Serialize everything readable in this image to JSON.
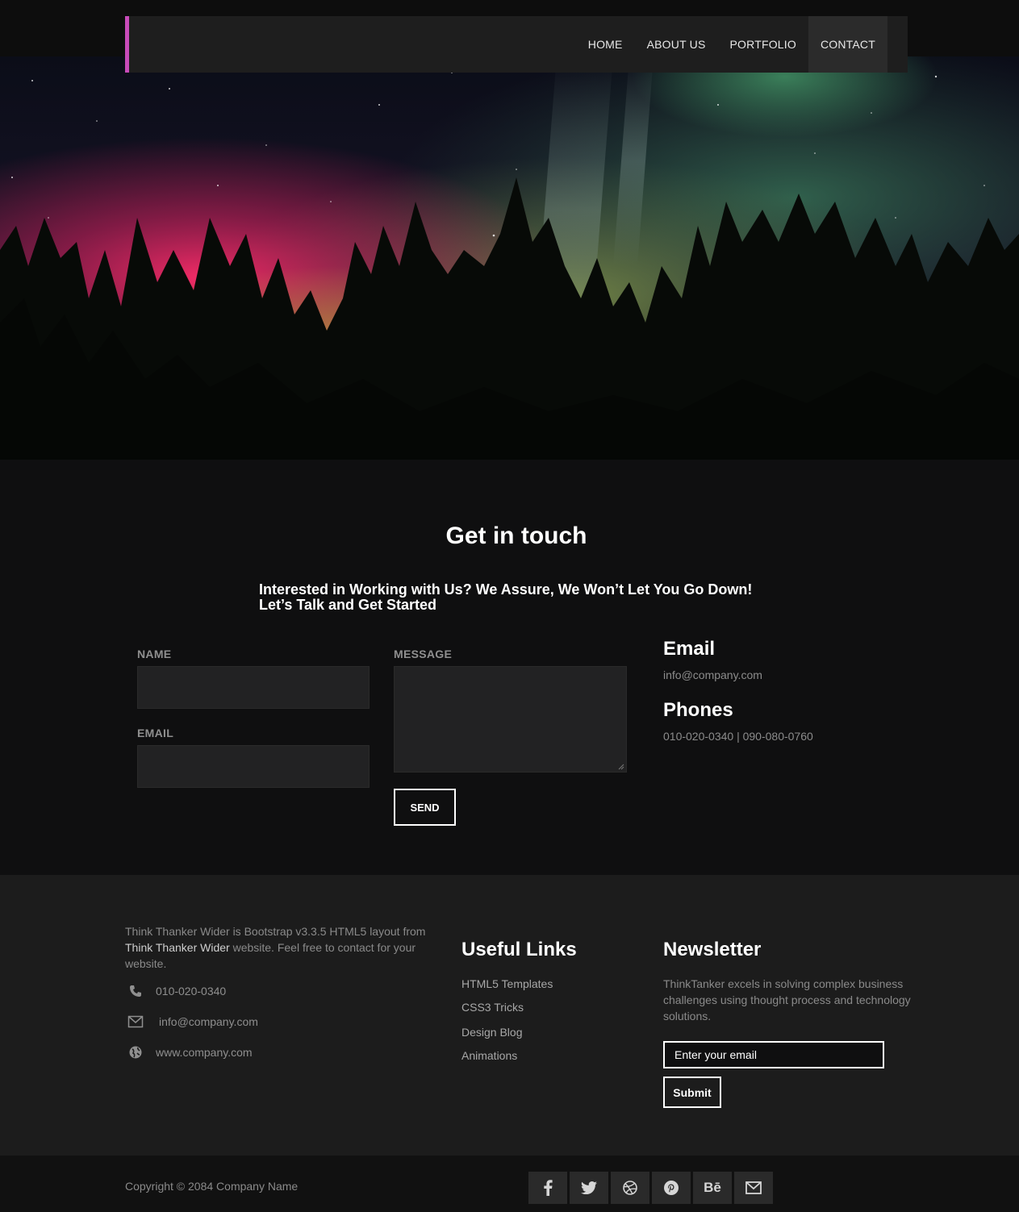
{
  "colors": {
    "accent": "#c84bb9",
    "background": "#0f0f10",
    "footer": "#1c1c1c",
    "nav": "#1e1e1e"
  },
  "nav": {
    "items": [
      {
        "label": "HOME",
        "active": false
      },
      {
        "label": "ABOUT US",
        "active": false
      },
      {
        "label": "PORTFOLIO",
        "active": false
      },
      {
        "label": "CONTACT",
        "active": true
      }
    ]
  },
  "contact": {
    "title": "Get in touch",
    "subtitle_line1": "Interested in Working with Us? We Assure, We Won’t Let You Go Down!",
    "subtitle_line2": "Let’s Talk and Get Started",
    "name_label": "NAME",
    "email_label": "EMAIL",
    "message_label": "MESSAGE",
    "send_label": "SEND",
    "email_heading": "Email",
    "email_value": "info@company.com",
    "phones_heading": "Phones",
    "phones_value": "010-020-0340 | 090-080-0760"
  },
  "footer": {
    "about_pre": "Think Thanker Wider is Bootstrap v3.3.5 HTML5 layout from",
    "about_link": "Think Thanker Wider",
    "about_post": "website. Feel free to contact for your website.",
    "phone": "010-020-0340",
    "email": "info@company.com",
    "website": "www.company.com",
    "links_heading": "Useful Links",
    "links": [
      "HTML5 Templates",
      "CSS3 Tricks",
      "Design Blog",
      "Animations"
    ],
    "newsletter_heading": "Newsletter",
    "newsletter_text": "ThinkTanker excels in solving complex business challenges using thought process and technology solutions.",
    "newsletter_placeholder": "Enter your email",
    "submit_label": "Submit"
  },
  "bottom": {
    "copyright": "Copyright © 2084 Company Name",
    "social": [
      "facebook-icon",
      "twitter-icon",
      "dribbble-icon",
      "pinterest-icon",
      "behance-icon",
      "envelope-icon"
    ],
    "behance_label": "Bē"
  }
}
